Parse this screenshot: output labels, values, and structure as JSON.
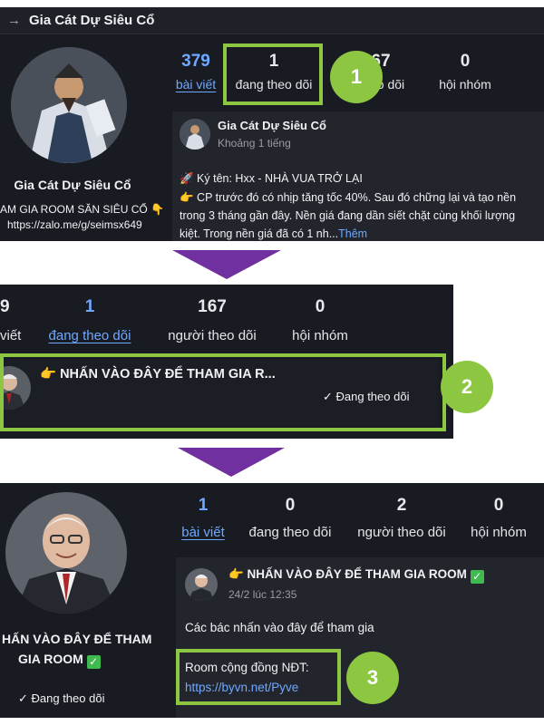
{
  "panel1": {
    "back_arrow": "→",
    "header_title": "Gia Cát Dự Siêu Cổ",
    "profile_name": "Gia Cát Dự Siêu Cổ",
    "profile_bio": "AM GIA ROOM SĂN SIÊU CỔ 👇",
    "profile_link": "https://zalo.me/g/seimsx649",
    "stats": [
      {
        "num": "379",
        "label": "bài viết"
      },
      {
        "num": "1",
        "label": "đang theo dõi"
      },
      {
        "num": "67",
        "label": "eo dõi"
      },
      {
        "num": "0",
        "label": "hội nhóm"
      }
    ],
    "post": {
      "author": "Gia Cát Dự Siêu Cổ",
      "time": "Khoảng 1 tiếng",
      "line1": "🚀 Ký tên: Hxx - NHÀ VUA TRỞ LẠI",
      "line2": "👉 CP trước đó có nhịp tăng tốc 40%. Sau đó chững lại và tạo nền",
      "line3": "trong 3 tháng gần đây. Nền giá đang dần siết chặt cùng khối lượng",
      "line4": "kiệt. Trong nền giá đã có 1 nh...",
      "more": "Thêm"
    },
    "badge": "1"
  },
  "panel2": {
    "stats": [
      {
        "num": "9",
        "label": "viết"
      },
      {
        "num": "1",
        "label": "đang theo dõi"
      },
      {
        "num": "167",
        "label": "người theo dõi"
      },
      {
        "num": "0",
        "label": "hội nhóm"
      }
    ],
    "following_name": "👉 NHẤN VÀO ĐÂY ĐỂ THAM GIA R...",
    "following_status": "✓  Đang theo dõi",
    "badge": "2"
  },
  "panel3": {
    "profile_name_line1": "HẤN VÀO ĐÂY ĐỂ THAM",
    "profile_name_line2": "GIA ROOM",
    "profile_status": "✓  Đang theo dõi",
    "stats": [
      {
        "num": "1",
        "label": "bài viết"
      },
      {
        "num": "0",
        "label": "đang theo dõi"
      },
      {
        "num": "2",
        "label": "người theo dõi"
      },
      {
        "num": "0",
        "label": "hội nhóm"
      }
    ],
    "post": {
      "author": "👉 NHẤN VÀO ĐÂY ĐỂ THAM GIA ROOM",
      "time": "24/2 lúc 12:35",
      "body": "Các bác nhấn vào đây để tham gia",
      "room_label": "Room cộng đồng NĐT:",
      "room_link": "https://byvn.net/Pyve"
    },
    "badge": "3"
  },
  "colors": {
    "panel_bg": "#191b22",
    "accent_blue": "#6ea8ff",
    "highlight_green": "#8dc641",
    "arrow_purple": "#7030a0"
  }
}
